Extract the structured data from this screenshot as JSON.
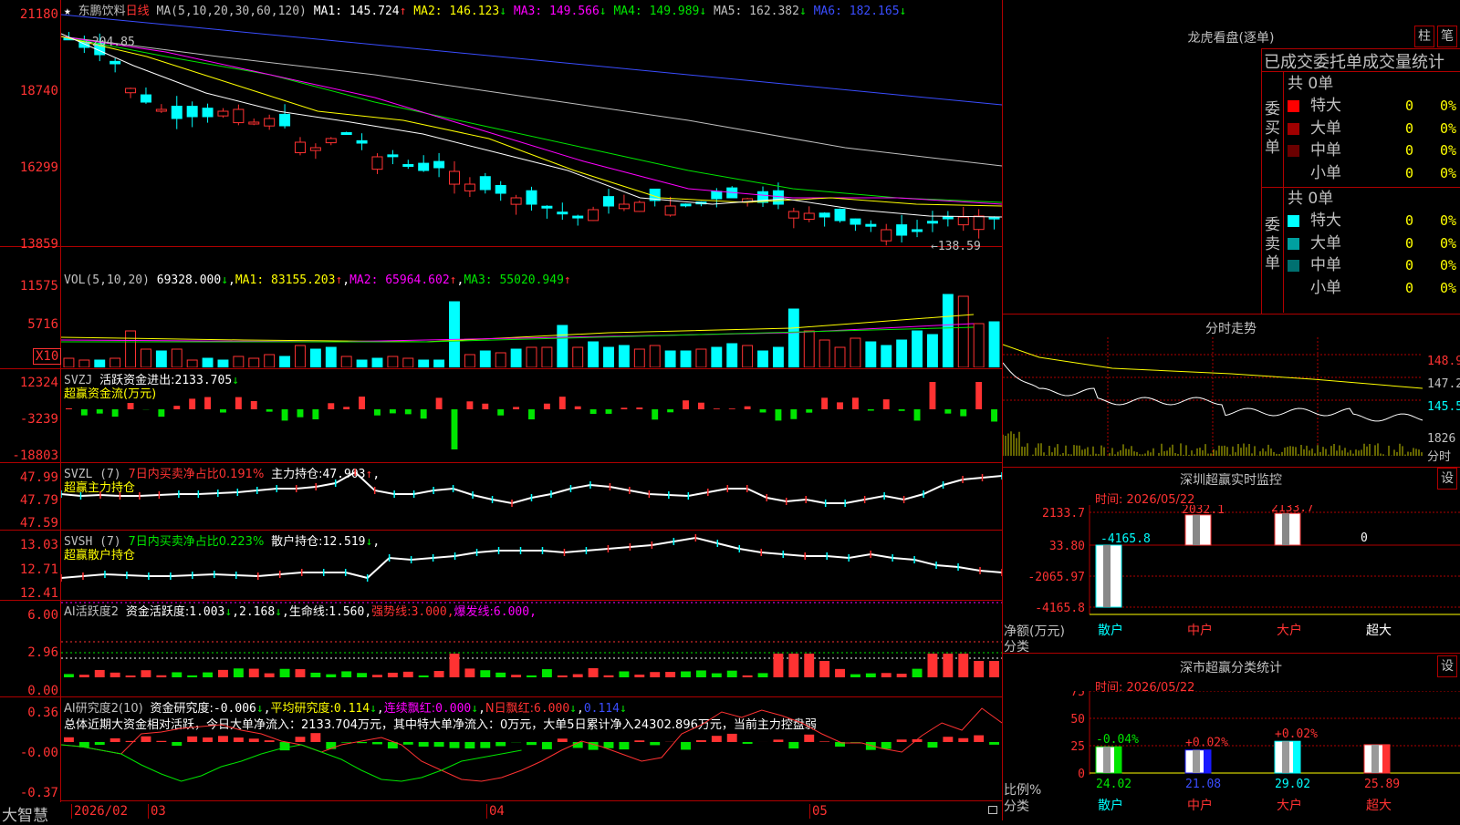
{
  "stock": {
    "name": "东鹏饮料",
    "period": "日线",
    "star": "★"
  },
  "ma_line": {
    "label": "MA(5,10,20,30,60,120)",
    "items": [
      {
        "name": "MA1",
        "value": "145.724",
        "arrow": "↑",
        "color": "#ffffff"
      },
      {
        "name": "MA2",
        "value": "146.123",
        "arrow": "↓",
        "color": "#ffff00"
      },
      {
        "name": "MA3",
        "value": "149.566",
        "arrow": "↓",
        "color": "#ff00ff"
      },
      {
        "name": "MA4",
        "value": "149.989",
        "arrow": "↓",
        "color": "#00e600"
      },
      {
        "name": "MA5",
        "value": "162.382",
        "arrow": "↓",
        "color": "#c0c0c0"
      },
      {
        "name": "MA6",
        "value": "182.165",
        "arrow": "↓",
        "color": "#3a4dff"
      }
    ]
  },
  "price_axis": [
    "21180",
    "18740",
    "16299",
    "13859"
  ],
  "price_annotations": {
    "high": "204.85",
    "low": "138.59",
    "low_arrow": "←"
  },
  "vol": {
    "label": "VOL(5,10,20)",
    "value": "69328.000",
    "arrow": "↓",
    "ma": [
      {
        "name": "MA1",
        "value": "83155.203",
        "arrow": "↑",
        "color": "#ffff00"
      },
      {
        "name": "MA2",
        "value": "65964.602",
        "arrow": "↑",
        "color": "#ff00ff"
      },
      {
        "name": "MA3",
        "value": "55020.949",
        "arrow": "↑",
        "color": "#00e600"
      }
    ],
    "axis": [
      "11575",
      "5716"
    ],
    "unit": "X10"
  },
  "svzj": {
    "label": "SVZJ",
    "text": "活跃资金进出:",
    "value": "2133.705",
    "arrow": "↓",
    "sub": "超赢资金流(万元)",
    "axis": [
      "12324",
      "-3239",
      "-18803"
    ]
  },
  "svzl": {
    "label": "SVZL (7)",
    "pct_text": "7日内买卖净占比0.191%",
    "hold_text": "主力持仓:",
    "hold": "47.903",
    "arrow": "↑",
    "sub": "超赢主力持仓",
    "axis": [
      "47.99",
      "47.79",
      "47.59"
    ]
  },
  "svsh": {
    "label": "SVSH (7)",
    "pct_text": "7日内买卖净占比0.223%",
    "hold_text": "散户持仓:",
    "hold": "12.519",
    "arrow": "↓",
    "sub": "超赢散户持仓",
    "axis": [
      "13.03",
      "12.71",
      "12.41"
    ]
  },
  "ai_active": {
    "label": "AI活跃度2",
    "t1": "资金活跃度:",
    "v1": "1.003",
    "v2": "2.168",
    "t3": "生命线:",
    "v3": "1.560",
    "t4": "强势线:",
    "v4": "3.000",
    "t5": "爆发线:",
    "v5": "6.000",
    "axis": [
      "6.00",
      "2.96",
      "0.00"
    ]
  },
  "ai_research": {
    "label": "AI研究度2(10)",
    "t1": "资金研究度:",
    "v1": "-0.006",
    "t2": "平均研究度:",
    "v2": "0.114",
    "t3": "连续飘红:",
    "v3": "0.000",
    "t4": "N日飘红:",
    "v4": "6.000",
    "v5": "0.114",
    "summary": "总体近期大资金相对活跃，今日大单净流入：2133.704万元，其中特大单净流入：0万元，大单5日累计净入24302.896万元，当前主力控盘弱",
    "axis": [
      "0.36",
      "-0.00",
      "-0.37"
    ]
  },
  "date_axis": {
    "brand": "大智慧",
    "labels": [
      "2026/02",
      "03",
      "04",
      "05"
    ]
  },
  "lhb": {
    "title": "龙虎看盘(逐单)",
    "btn1": "柱",
    "btn2": "笔",
    "header": "已成交委托单成交量统计",
    "buy": {
      "side": "委买单",
      "total": "共 0单",
      "rows": [
        {
          "label": "特大",
          "count": "0",
          "pct": "0%",
          "color": "#ff0000"
        },
        {
          "label": "大单",
          "count": "0",
          "pct": "0%",
          "color": "#a00000"
        },
        {
          "label": "中单",
          "count": "0",
          "pct": "0%",
          "color": "#6a0000"
        },
        {
          "label": "小单",
          "count": "0",
          "pct": "0%",
          "color": "#000000"
        }
      ]
    },
    "sell": {
      "side": "委卖单",
      "total": "共 0单",
      "rows": [
        {
          "label": "特大",
          "count": "0",
          "pct": "0%",
          "color": "#00ffff"
        },
        {
          "label": "大单",
          "count": "0",
          "pct": "0%",
          "color": "#00a0a0"
        },
        {
          "label": "中单",
          "count": "0",
          "pct": "0%",
          "color": "#007070"
        },
        {
          "label": "小单",
          "count": "0",
          "pct": "0%",
          "color": "#000000"
        }
      ]
    }
  },
  "intraday": {
    "title": "分时走势",
    "price_labels": [
      "148.9",
      "147.2",
      "145.5"
    ],
    "vol_label": "1826",
    "vol_unit": "分时"
  },
  "sz_monitor": {
    "title": "深圳超赢实时监控",
    "btn": "设",
    "time": "时间: 2026/05/22",
    "axis": [
      "2133.7",
      "33.80",
      "-2065.97",
      "-4165.8"
    ],
    "bars": [
      {
        "cat": "散户",
        "value": -4165.8,
        "label": "-4165.8",
        "cat_color": "#00ffff"
      },
      {
        "cat": "中户",
        "value": 2032.1,
        "label": "2032.1",
        "cat_color": "#ff3232"
      },
      {
        "cat": "大户",
        "value": 2133.7,
        "label": "2133.7",
        "cat_color": "#ff3232"
      },
      {
        "cat": "超大",
        "value": 0,
        "label": "0",
        "cat_color": "#ffffff"
      }
    ],
    "ylabel": "净额(万元)",
    "xlabel": "分类"
  },
  "sz_class": {
    "title": "深市超赢分类统计",
    "btn": "设",
    "time": "时间: 2026/05/22",
    "axis": [
      "75",
      "50",
      "25",
      "0"
    ],
    "bars": [
      {
        "cat": "散户",
        "pct": 24.02,
        "label": "24.02",
        "chg": "-0.04%",
        "chg_color": "#00e600",
        "color": "#00e600",
        "cat_color": "#00ffff"
      },
      {
        "cat": "中户",
        "pct": 21.08,
        "label": "21.08",
        "chg": "+0.02%",
        "chg_color": "#ff3232",
        "color": "#1a1aff",
        "cat_color": "#ff3232"
      },
      {
        "cat": "大户",
        "pct": 29.02,
        "label": "29.02",
        "chg": "+0.02%",
        "chg_color": "#ff3232",
        "color": "#00ffff",
        "cat_color": "#ff3232"
      },
      {
        "cat": "超大",
        "pct": 25.89,
        "label": "25.89",
        "chg": "",
        "chg_color": "#ff3232",
        "color": "#ff3232",
        "cat_color": "#ff3232"
      }
    ],
    "ylabel": "比例%",
    "xlabel": "分类"
  }
}
